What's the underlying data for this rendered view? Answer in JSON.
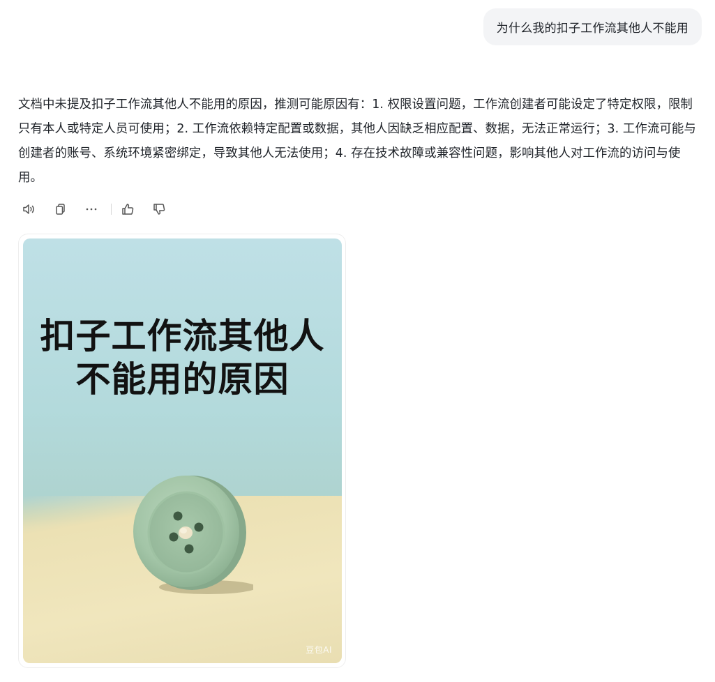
{
  "user_message": "为什么我的扣子工作流其他人不能用",
  "assistant": {
    "answer": "文档中未提及扣子工作流其他人不能用的原因，推测可能原因有：1. 权限设置问题，工作流创建者可能设定了特定权限，限制只有本人或特定人员可使用；2. 工作流依赖特定配置或数据，其他人因缺乏相应配置、数据，无法正常运行；3. 工作流可能与创建者的账号、系统环境紧密绑定，导致其他人无法使用；4. 存在技术故障或兼容性问题，影响其他人对工作流的访问与使用。"
  },
  "toolbar": {
    "icons": [
      "speaker-icon",
      "copy-icon",
      "more-icon",
      "thumbs-up-icon",
      "thumbs-down-icon"
    ]
  },
  "image_card": {
    "title_line1": "扣子工作流其他人",
    "title_line2": "不能用的原因",
    "watermark": "豆包AI"
  },
  "colors": {
    "user_bubble_bg": "#f3f4f6",
    "text": "#1f2329",
    "icon": "#555555",
    "button_green": "#a9c9ac"
  }
}
